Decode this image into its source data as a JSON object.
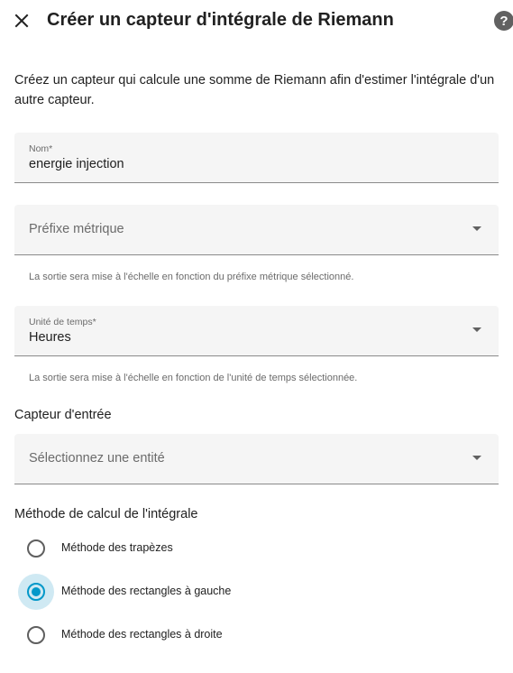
{
  "header": {
    "title": "Créer un capteur d'intégrale de Riemann",
    "help_label": "?"
  },
  "description": "Créez un capteur qui calcule une somme de Riemann afin d'estimer l'intégrale d'un autre capteur.",
  "fields": {
    "name": {
      "label": "Nom*",
      "value": "energie injection"
    },
    "metric_prefix": {
      "placeholder": "Préfixe métrique",
      "helper": "La sortie sera mise à l'échelle en fonction du préfixe métrique sélectionné."
    },
    "time_unit": {
      "label": "Unité de temps*",
      "value": "Heures",
      "helper": "La sortie sera mise à l'échelle en fonction de l'unité de temps sélectionnée."
    }
  },
  "input_sensor": {
    "title": "Capteur d'entrée",
    "placeholder": "Sélectionnez une entité"
  },
  "method": {
    "title": "Méthode de calcul de l'intégrale",
    "options": [
      {
        "label": "Méthode des trapèzes",
        "checked": false
      },
      {
        "label": "Méthode des rectangles à gauche",
        "checked": true
      },
      {
        "label": "Méthode des rectangles à droite",
        "checked": false
      }
    ]
  },
  "colors": {
    "accent": "#0398c9",
    "field_bg": "#f5f5f5",
    "halo": "#cfe9f3"
  },
  "icons": {
    "close": "close-icon",
    "help": "help-circle-icon",
    "dropdown": "menu-down-icon"
  }
}
